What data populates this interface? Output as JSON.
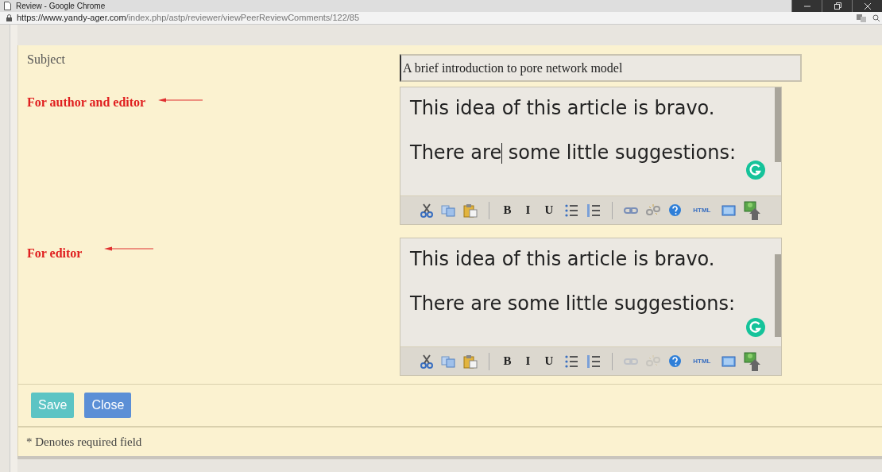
{
  "window": {
    "title": "Review - Google Chrome"
  },
  "address_bar": {
    "secure": true,
    "host": "https://www.yandy-ager.com",
    "path": "/index.php/astp/reviewer/viewPeerReviewComments/122/85"
  },
  "subject": {
    "label": "Subject",
    "value": "A brief introduction to pore network model"
  },
  "editors": [
    {
      "label": "For author and editor",
      "lines": [
        {
          "segments": [
            "This idea of this article is bravo."
          ]
        },
        {
          "segments": [
            "There are",
            " some little suggestions:"
          ]
        }
      ],
      "toolbar": [
        {
          "kind": "cut",
          "disabled": false
        },
        {
          "kind": "copy",
          "disabled": false
        },
        {
          "kind": "paste",
          "disabled": false
        },
        {
          "kind": "separator"
        },
        {
          "kind": "text",
          "label": "B",
          "disabled": false
        },
        {
          "kind": "text",
          "label": "I",
          "disabled": false
        },
        {
          "kind": "text",
          "label": "U",
          "disabled": false
        },
        {
          "kind": "bullets",
          "disabled": false
        },
        {
          "kind": "numbers",
          "disabled": false
        },
        {
          "kind": "separator"
        },
        {
          "kind": "link",
          "disabled": false
        },
        {
          "kind": "unlink",
          "disabled": false
        },
        {
          "kind": "help",
          "disabled": false
        },
        {
          "kind": "text",
          "label": "HTML",
          "disabled": false
        },
        {
          "kind": "fullscreen",
          "disabled": false
        },
        {
          "kind": "image",
          "disabled": false
        }
      ]
    },
    {
      "label": "For editor",
      "lines": [
        {
          "segments": [
            "This idea of this article is bravo."
          ]
        },
        {
          "segments": [
            "There are some little suggestions:"
          ]
        }
      ],
      "toolbar": [
        {
          "kind": "cut",
          "disabled": false
        },
        {
          "kind": "copy",
          "disabled": false
        },
        {
          "kind": "paste",
          "disabled": false
        },
        {
          "kind": "separator"
        },
        {
          "kind": "text",
          "label": "B",
          "disabled": false
        },
        {
          "kind": "text",
          "label": "I",
          "disabled": false
        },
        {
          "kind": "text",
          "label": "U",
          "disabled": false
        },
        {
          "kind": "bullets",
          "disabled": false
        },
        {
          "kind": "numbers",
          "disabled": false
        },
        {
          "kind": "separator"
        },
        {
          "kind": "link",
          "disabled": true
        },
        {
          "kind": "unlink",
          "disabled": true
        },
        {
          "kind": "help",
          "disabled": false
        },
        {
          "kind": "text",
          "label": "HTML",
          "disabled": false
        },
        {
          "kind": "fullscreen",
          "disabled": false
        },
        {
          "kind": "image",
          "disabled": false
        }
      ]
    }
  ],
  "buttons": [
    {
      "label": "Save",
      "kind": "save"
    },
    {
      "label": "Close",
      "kind": "close"
    }
  ],
  "footnote": "* Denotes required field"
}
